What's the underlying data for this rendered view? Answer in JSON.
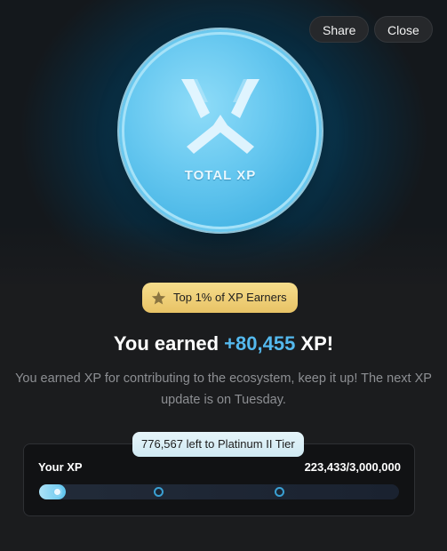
{
  "header": {
    "share_label": "Share",
    "close_label": "Close"
  },
  "coin": {
    "label": "TOTAL XP",
    "icon": "xp-logo-icon"
  },
  "badge": {
    "icon": "star-icon",
    "text": "Top 1% of XP Earners"
  },
  "headline": {
    "prefix": "You earned ",
    "amount": "+80,455",
    "suffix": " XP!"
  },
  "description": "You earned XP for contributing to the ecosystem, keep it up! The next XP update is on Tuesday.",
  "progress": {
    "tooltip": "776,567 left to Platinum II Tier",
    "label": "Your XP",
    "count_text": "223,433/3,000,000",
    "current": 223433,
    "max": 3000000,
    "milestones": 3
  },
  "colors": {
    "accent": "#54b9ee",
    "badge": "#f2d37c",
    "background": "#1b1c1e"
  }
}
